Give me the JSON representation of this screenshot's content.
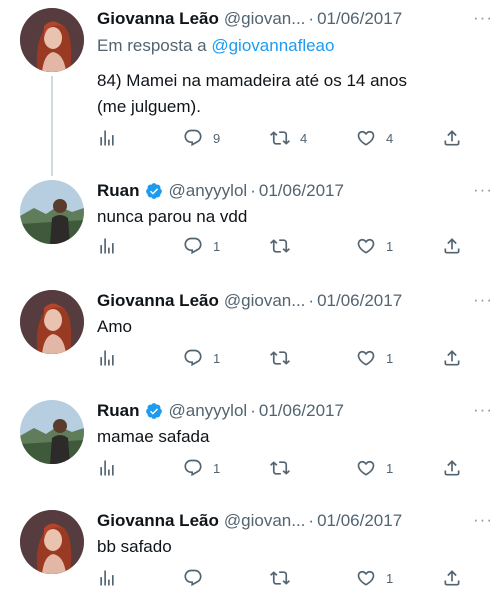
{
  "colors": {
    "accent": "#1d9bf0",
    "muted": "#536471",
    "text": "#0f1419",
    "verified": "#1d9bf0"
  },
  "tweets": [
    {
      "name": "Giovanna Leão",
      "handle": "@giovan...",
      "date": "01/06/2017",
      "reply_prefix": "Em resposta a",
      "reply_handle": "@giovannafleao",
      "text": [
        "84) Mamei na mamadeira até os 14 anos",
        "(me julguem)."
      ],
      "replies": "9",
      "retweets": "4",
      "likes": "4",
      "verified": false,
      "avatar": "woman-red-hair-avatar"
    },
    {
      "name": "Ruan",
      "handle": "@anyyylol",
      "date": "01/06/2017",
      "text": [
        "nunca parou na vdd"
      ],
      "replies": "1",
      "retweets": "",
      "likes": "1",
      "verified": true,
      "avatar": "man-landscape-avatar"
    },
    {
      "name": "Giovanna Leão",
      "handle": "@giovan...",
      "date": "01/06/2017",
      "text": [
        "Amo"
      ],
      "replies": "1",
      "retweets": "",
      "likes": "1",
      "verified": false,
      "avatar": "woman-red-hair-avatar"
    },
    {
      "name": "Ruan",
      "handle": "@anyyylol",
      "date": "01/06/2017",
      "text": [
        "mamae safada"
      ],
      "replies": "1",
      "retweets": "",
      "likes": "1",
      "verified": true,
      "avatar": "man-landscape-avatar"
    },
    {
      "name": "Giovanna Leão",
      "handle": "@giovan...",
      "date": "01/06/2017",
      "text": [
        "bb safado"
      ],
      "replies": "",
      "retweets": "",
      "likes": "1",
      "verified": false,
      "avatar": "woman-red-hair-avatar"
    }
  ],
  "ui": {
    "separator": "·",
    "more": "···"
  }
}
